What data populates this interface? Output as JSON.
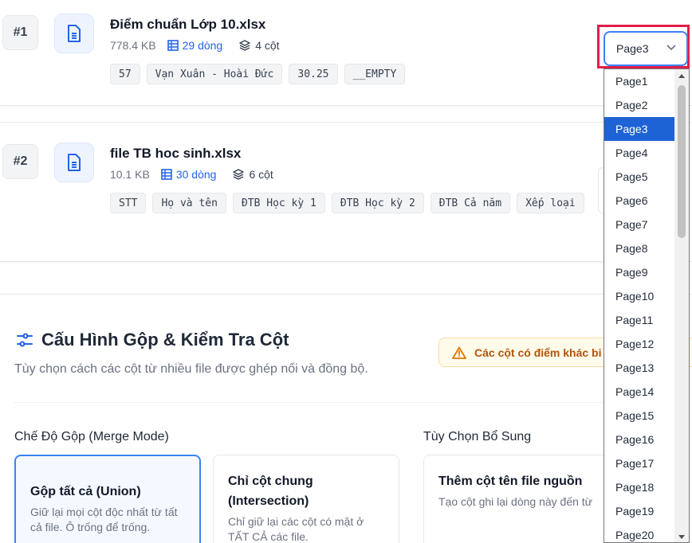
{
  "files": [
    {
      "rank": "#1",
      "name": "Điểm chuẩn Lớp 10.xlsx",
      "size": "778.4 KB",
      "rows": "29 dòng",
      "cols": "4 cột",
      "chips": [
        "57",
        "Vạn Xuân - Hoài Đức",
        "30.25",
        "__EMPTY"
      ]
    },
    {
      "rank": "#2",
      "name": "file TB hoc sinh.xlsx",
      "size": "10.1 KB",
      "rows": "30 dòng",
      "cols": "6 cột",
      "chips": [
        "STT",
        "Họ và tên",
        "ĐTB Học kỳ 1",
        "ĐTB Học kỳ 2",
        "ĐTB Cả năm",
        "Xếp loại"
      ]
    }
  ],
  "config": {
    "title": "Cấu Hình Gộp & Kiểm Tra Cột",
    "subtitle": "Tùy chọn cách các cột từ nhiều file được ghép nối và đồng bộ.",
    "warning": "Các cột có điểm khác bi",
    "mode_label": "Chế Độ Gộp (Merge Mode)",
    "extra_label": "Tùy Chọn Bổ Sung",
    "options": [
      {
        "title": "Gộp tất cả (Union)",
        "desc": "Giữ lại mọi cột độc nhất từ tất cả file. Ô trống để trống."
      },
      {
        "title": "Chỉ cột chung (Intersection)",
        "desc": "Chỉ giữ lại các cột có mặt ở TẤT CẢ các file."
      },
      {
        "title": "Thêm cột tên file nguồn",
        "desc": "Tạo cột ghi lại dòng này đến từ"
      }
    ]
  },
  "sheet_select": {
    "value": "Page3",
    "options": [
      "Page1",
      "Page2",
      "Page3",
      "Page4",
      "Page5",
      "Page6",
      "Page7",
      "Page8",
      "Page9",
      "Page10",
      "Page11",
      "Page12",
      "Page13",
      "Page14",
      "Page15",
      "Page16",
      "Page17",
      "Page18",
      "Page19",
      "Page20"
    ],
    "selected_index": 2
  },
  "colors": {
    "accent": "#2563eb",
    "selected_option": "#1e63d6",
    "highlight": "#e11d48",
    "warning": "#b45309"
  }
}
